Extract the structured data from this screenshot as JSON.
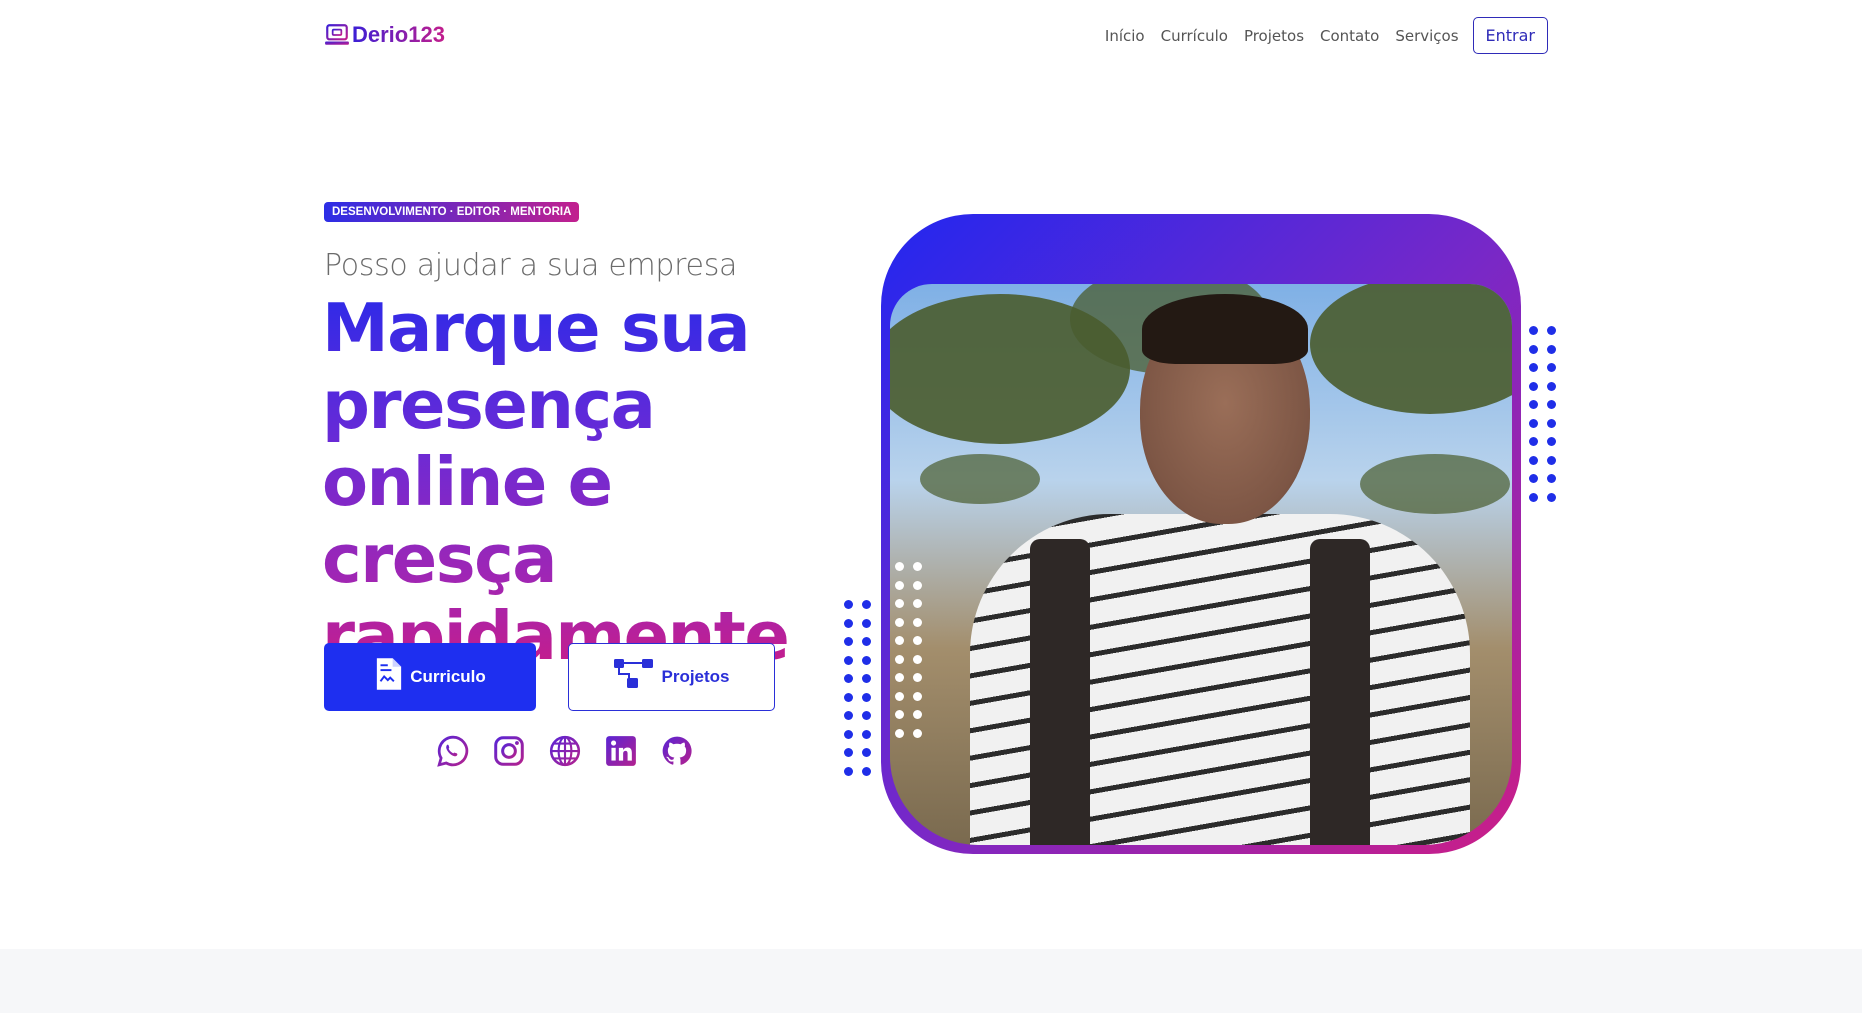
{
  "brand": {
    "name": "Derio123",
    "icon": "laptop-icon"
  },
  "nav": {
    "links": [
      "Início",
      "Currículo",
      "Projetos",
      "Contato",
      "Serviços"
    ],
    "login_label": "Entrar"
  },
  "hero": {
    "badge": "DESENVOLVIMENTO · EDITOR · MENTORIA",
    "subtitle": "Posso ajudar a sua empresa",
    "headline_lines": [
      "Marque sua",
      "presença",
      "online e cresça",
      "rapidamente"
    ],
    "buttons": {
      "curriculo": {
        "label": "Curriculo",
        "icon": "document-icon"
      },
      "projetos": {
        "label": "Projetos",
        "icon": "diagram-icon"
      }
    },
    "socials": [
      "whatsapp-icon",
      "instagram-icon",
      "globe-icon",
      "linkedin-icon",
      "github-icon"
    ]
  },
  "colors": {
    "primary": "#1e2ff0",
    "gradient_start": "#2227f0",
    "gradient_mid": "#7728c8",
    "gradient_end": "#cc1e86"
  }
}
